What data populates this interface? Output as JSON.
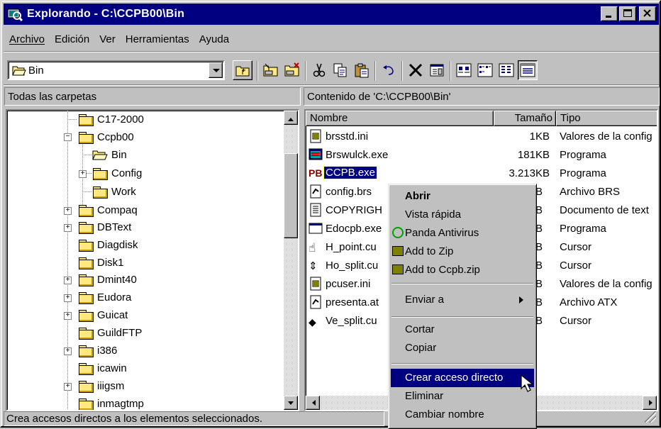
{
  "window": {
    "title": "Explorando - C:\\CCPB00\\Bin"
  },
  "menubar": [
    {
      "label": "Archivo"
    },
    {
      "label": "Edición"
    },
    {
      "label": "Ver"
    },
    {
      "label": "Herramientas"
    },
    {
      "label": "Ayuda"
    }
  ],
  "toolbar": {
    "address_value": "Bin",
    "buttons": [
      "up-folder-icon",
      "map-drive-icon",
      "disconnect-drive-icon",
      "cut-icon",
      "copy-icon",
      "paste-icon",
      "undo-icon",
      "delete-icon",
      "properties-icon",
      "large-icons-icon",
      "small-icons-icon",
      "list-icon",
      "details-icon"
    ]
  },
  "left_pane": {
    "header": "Todas las carpetas",
    "folders": [
      "C17-2000",
      "Ccpb00",
      "Bin",
      "Config",
      "Work",
      "Compaq",
      "DBText",
      "Diagdisk",
      "Disk1",
      "Dmint40",
      "Eudora",
      "Guicat",
      "GuildFTP",
      "i386",
      "icawin",
      "iiigsm",
      "inmagtmp"
    ]
  },
  "right_pane": {
    "header": "Contenido de 'C:\\CCPB00\\Bin'",
    "columns": [
      "Nombre",
      "Tamaño",
      "Tipo"
    ],
    "files": [
      {
        "name": "brsstd.ini",
        "size": "1KB",
        "type": "Valores de la config"
      },
      {
        "name": "Brswulck.exe",
        "size": "181KB",
        "type": "Programa"
      },
      {
        "name": "CCPB.exe",
        "size": "3.213KB",
        "type": "Programa"
      },
      {
        "name": "config.brs",
        "size": "B",
        "type": "Archivo BRS"
      },
      {
        "name": "COPYRIGH",
        "size": "B",
        "type": "Documento de text"
      },
      {
        "name": "Edocpb.exe",
        "size": "B",
        "type": "Programa"
      },
      {
        "name": "H_point.cu",
        "size": "B",
        "type": "Cursor"
      },
      {
        "name": "Ho_split.cu",
        "size": "B",
        "type": "Cursor"
      },
      {
        "name": "pcuser.ini",
        "size": "B",
        "type": "Valores de la config"
      },
      {
        "name": "presenta.at",
        "size": "B",
        "type": "Archivo ATX"
      },
      {
        "name": "Ve_split.cu",
        "size": "B",
        "type": "Cursor"
      }
    ]
  },
  "context_menu": {
    "items": [
      {
        "label": "Abrir"
      },
      {
        "label": "Vista rápida"
      },
      {
        "label": "Panda Antivirus"
      },
      {
        "label": "Add to Zip"
      },
      {
        "label": "Add to Ccpb.zip"
      },
      {
        "label": "Enviar a"
      },
      {
        "label": "Cortar"
      },
      {
        "label": "Copiar"
      },
      {
        "label": "Crear acceso directo"
      },
      {
        "label": "Eliminar"
      },
      {
        "label": "Cambiar nombre"
      }
    ]
  },
  "status": {
    "text": "Crea accesos directos a los elementos seleccionados."
  },
  "colors": {
    "title_bar": "#000080",
    "selection": "#000080",
    "face": "#c0c0c0"
  }
}
